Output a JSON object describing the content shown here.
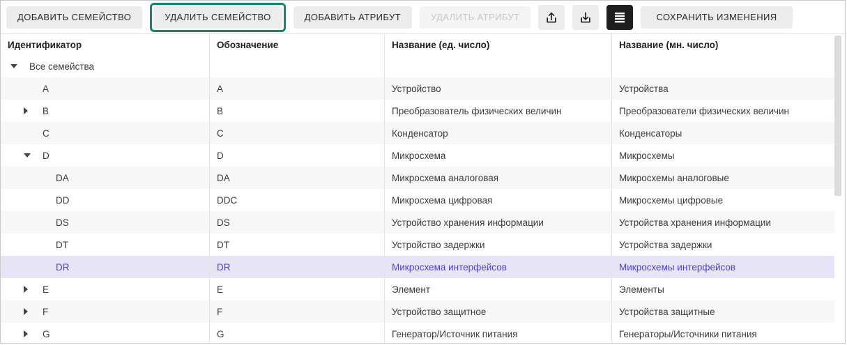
{
  "toolbar": {
    "add_family": "ДОБАВИТЬ СЕМЕЙСТВО",
    "delete_family": "УДАЛИТЬ СЕМЕЙСТВО",
    "add_attribute": "ДОБАВИТЬ АТРИБУТ",
    "delete_attribute": "УДАЛИТЬ АТРИБУТ",
    "save_changes": "СОХРАНИТЬ ИЗМЕНЕНИЯ",
    "icons": {
      "upload": "upload-icon",
      "download": "download-icon",
      "list": "list-icon"
    }
  },
  "colors": {
    "accent_green": "#0e8a66",
    "selected_row_bg": "#e7e4f8",
    "selected_row_text": "#4f43c8"
  },
  "table": {
    "columns": [
      "Идентификатор",
      "Обозначение",
      "Название (ед. число)",
      "Название (мн. число)"
    ],
    "rows": [
      {
        "identifier": "Все семейства",
        "designation": "",
        "singular": "",
        "plural": "",
        "level": 0,
        "toggle": "expanded",
        "selected": false
      },
      {
        "identifier": "A",
        "designation": "A",
        "singular": "Устройство",
        "plural": "Устройства",
        "level": 1,
        "toggle": "none",
        "selected": false
      },
      {
        "identifier": "B",
        "designation": "B",
        "singular": "Преобразователь физических величин",
        "plural": "Преобразователи физических величин",
        "level": 1,
        "toggle": "collapsed",
        "selected": false
      },
      {
        "identifier": "C",
        "designation": "C",
        "singular": "Конденсатор",
        "plural": "Конденсаторы",
        "level": 1,
        "toggle": "none",
        "selected": false
      },
      {
        "identifier": "D",
        "designation": "D",
        "singular": "Микросхема",
        "plural": "Микросхемы",
        "level": 1,
        "toggle": "expanded",
        "selected": false
      },
      {
        "identifier": "DA",
        "designation": "DA",
        "singular": "Микросхема аналоговая",
        "plural": "Микросхемы аналоговые",
        "level": 2,
        "toggle": "none",
        "selected": false
      },
      {
        "identifier": "DD",
        "designation": "DDC",
        "singular": "Микросхема цифровая",
        "plural": "Микросхемы цифровые",
        "level": 2,
        "toggle": "none",
        "selected": false
      },
      {
        "identifier": "DS",
        "designation": "DS",
        "singular": "Устройство хранения информации",
        "plural": "Устройства хранения информации",
        "level": 2,
        "toggle": "none",
        "selected": false
      },
      {
        "identifier": "DT",
        "designation": "DT",
        "singular": "Устройство задержки",
        "plural": "Устройства задержки",
        "level": 2,
        "toggle": "none",
        "selected": false
      },
      {
        "identifier": "DR",
        "designation": "DR",
        "singular": "Микросхема интерфейсов",
        "plural": "Микросхемы интерфейсов",
        "level": 2,
        "toggle": "none",
        "selected": true
      },
      {
        "identifier": "E",
        "designation": "E",
        "singular": "Элемент",
        "plural": "Элементы",
        "level": 1,
        "toggle": "collapsed",
        "selected": false
      },
      {
        "identifier": "F",
        "designation": "F",
        "singular": "Устройство защитное",
        "plural": "Устройства защитные",
        "level": 1,
        "toggle": "collapsed",
        "selected": false
      },
      {
        "identifier": "G",
        "designation": "G",
        "singular": "Генератор/Источник питания",
        "plural": "Генераторы/Источники питания",
        "level": 1,
        "toggle": "collapsed",
        "selected": false
      }
    ]
  }
}
